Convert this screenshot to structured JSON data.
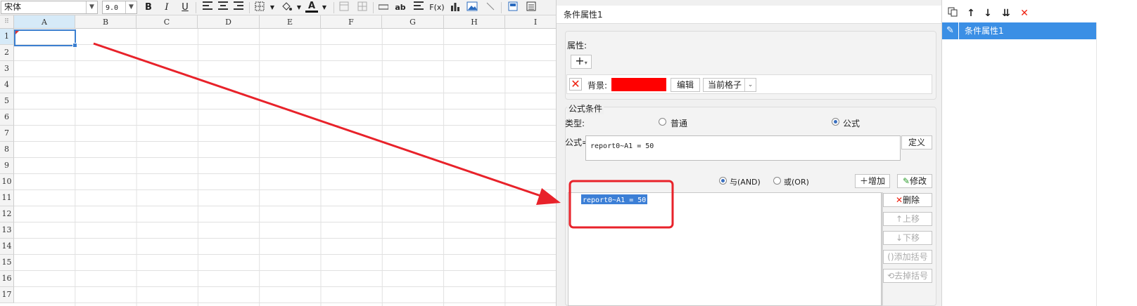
{
  "toolbar": {
    "font_name": "宋体",
    "font_size": "9.0",
    "bold": "B",
    "italic": "I",
    "underline": "U",
    "icons": [
      "align-left-icon",
      "align-center-icon",
      "align-right-icon",
      "border-icon",
      "fill-color-icon",
      "font-color-icon",
      "merge-icon",
      "unmerge-icon",
      "field-icon",
      "text-ab-icon",
      "paragraph-icon",
      "formula-icon",
      "chart-icon",
      "image-icon",
      "slash-icon",
      "widget-icon",
      "list-icon"
    ],
    "ab_label": "ab",
    "fx_label": "F(x)"
  },
  "sheet": {
    "columns": [
      "A",
      "B",
      "C",
      "D",
      "E",
      "F",
      "G",
      "H",
      "I"
    ],
    "rows": [
      "1",
      "2",
      "3",
      "4",
      "5",
      "6",
      "7",
      "8",
      "9",
      "10",
      "11",
      "12",
      "13",
      "14",
      "15",
      "16",
      "17"
    ],
    "selected_cell": "A1"
  },
  "dialog": {
    "title": "条件属性1",
    "attributes_label": "属性:",
    "add_symbol": "+",
    "background_label": "背景:",
    "background_color": "#ff0000",
    "edit_button": "编辑",
    "scope_select": "当前格子",
    "formula_cond_label": "公式条件",
    "type_label": "类型:",
    "type_normal": "普通",
    "type_formula": "公式",
    "formula_label": "公式=",
    "formula_value": "report0~A1 = 50",
    "define_button": "定义",
    "and_label": "与(AND)",
    "or_label": "或(OR)",
    "add_button": "增加",
    "modify_button": "修改",
    "delete_button": "删除",
    "up_button": "上移",
    "down_button": "下移",
    "add_bracket_button": "添加括号",
    "remove_bracket_button": "去掉括号",
    "condition_items": [
      "report0~A1 = 50"
    ]
  },
  "right_panel": {
    "selected_item": "条件属性1"
  },
  "colors": {
    "accent": "#3b8fe5",
    "annotation": "#e8222a"
  }
}
